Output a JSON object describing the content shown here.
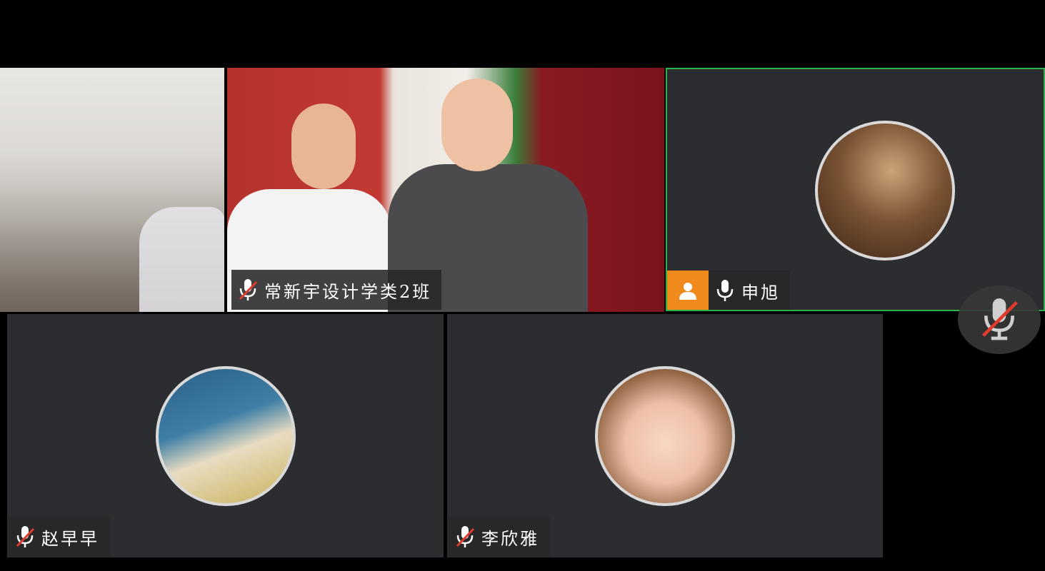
{
  "participants": [
    {
      "id": "video-a",
      "type": "video",
      "name": ""
    },
    {
      "id": "video-b",
      "type": "video",
      "name": "常新宇设计学类2班",
      "muted": true
    },
    {
      "id": "shenxu",
      "type": "avatar",
      "name": "申旭",
      "muted": false,
      "active_speaker": true,
      "badge_icon": "person-icon"
    },
    {
      "id": "zhao",
      "type": "avatar",
      "name": "赵早早",
      "muted": true
    },
    {
      "id": "li",
      "type": "avatar",
      "name": "李欣雅",
      "muted": true
    }
  ],
  "controls": {
    "self_mic": "muted",
    "icon": "mic-muted-icon"
  },
  "colors": {
    "tile_bg": "#2b2d30",
    "active_border": "#2bb24c",
    "badge": "#f08a1c",
    "mute_slash": "#e03a2e"
  }
}
